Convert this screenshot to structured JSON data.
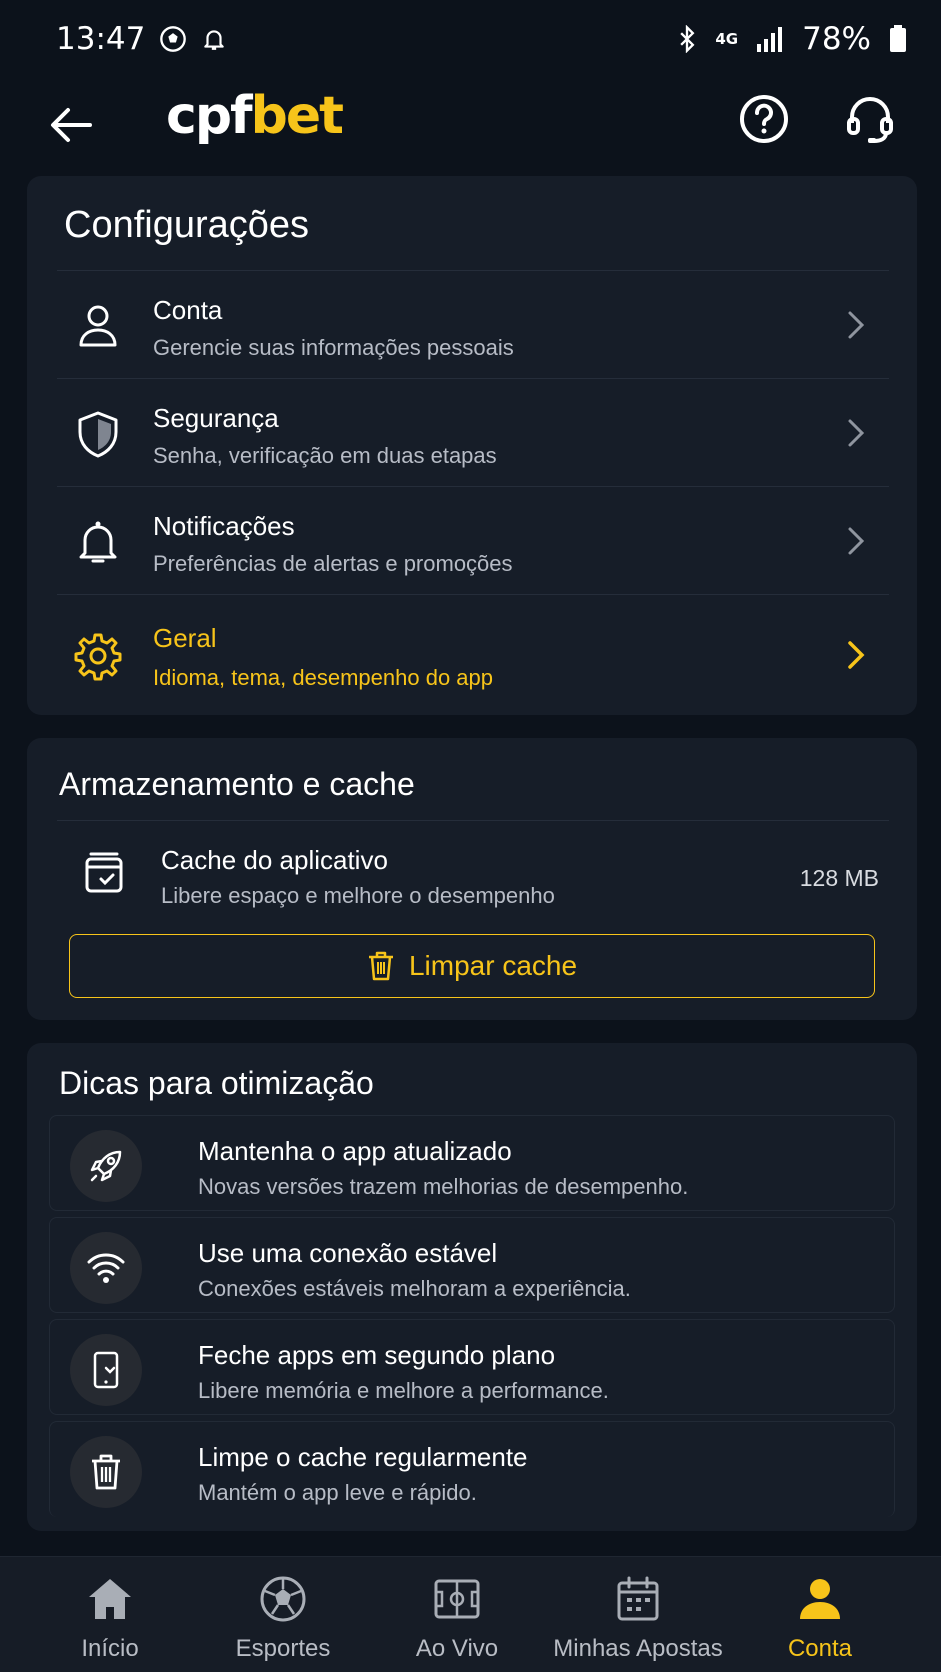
{
  "status_bar": {
    "time": "13:47",
    "network": "4G",
    "battery": "78%"
  },
  "header": {
    "logo_part1": "cpf",
    "logo_part2": "bet"
  },
  "settings": {
    "title": "Configurações",
    "items": [
      {
        "title": "Conta",
        "subtitle": "Gerencie suas informações pessoais",
        "icon": "user-icon"
      },
      {
        "title": "Segurança",
        "subtitle": "Senha, verificação em duas etapas",
        "icon": "shield-icon"
      },
      {
        "title": "Notificações",
        "subtitle": "Preferências de alertas e promoções",
        "icon": "bell-icon"
      },
      {
        "title": "Geral",
        "subtitle": "Idioma, tema, desempenho do app",
        "icon": "gear-icon",
        "active": true
      }
    ]
  },
  "storage": {
    "title": "Armazenamento e cache",
    "cache_title": "Cache do aplicativo",
    "cache_subtitle": "Libere espaço e melhore o desempenho",
    "cache_size": "128 MB",
    "clear_button": "Limpar cache"
  },
  "tips": {
    "title": "Dicas para otimização",
    "items": [
      {
        "title": "Mantenha o app atualizado",
        "subtitle": "Novas versões trazem melhorias de desempenho.",
        "icon": "rocket-icon"
      },
      {
        "title": "Use uma conexão estável",
        "subtitle": "Conexões estáveis melhoram a experiência.",
        "icon": "wifi-icon"
      },
      {
        "title": "Feche apps em segundo plano",
        "subtitle": "Libere memória e melhore a performance.",
        "icon": "phone-icon"
      },
      {
        "title": "Limpe o cache regularmente",
        "subtitle": "Mantém o app leve e rápido.",
        "icon": "trash-icon"
      }
    ]
  },
  "bottom_nav": {
    "items": [
      {
        "label": "Início",
        "icon": "home-icon"
      },
      {
        "label": "Esportes",
        "icon": "soccer-ball-icon"
      },
      {
        "label": "Ao Vivo",
        "icon": "field-icon"
      },
      {
        "label": "Minhas Apostas",
        "icon": "calendar-icon"
      },
      {
        "label": "Conta",
        "icon": "user-icon",
        "active": true
      }
    ]
  },
  "colors": {
    "accent": "#f7c41a",
    "background": "#0c121b",
    "card": "#161d28"
  }
}
